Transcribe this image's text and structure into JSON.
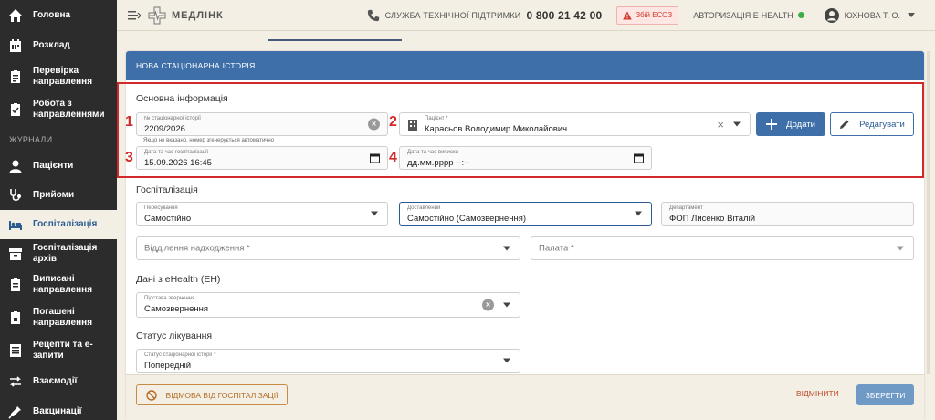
{
  "sidebar": {
    "items": [
      {
        "label": "Головна",
        "icon": "home-icon"
      },
      {
        "label": "Розклад",
        "icon": "calendar-icon"
      },
      {
        "label": "Перевірка направлення",
        "icon": "clipboard-check-icon"
      },
      {
        "label": "Робота з направленнями",
        "icon": "clipboard-list-icon"
      }
    ],
    "section": "ЖУРНАЛИ",
    "journal_items": [
      {
        "label": "Пацієнти",
        "icon": "person-icon"
      },
      {
        "label": "Прийоми",
        "icon": "stethoscope-icon"
      },
      {
        "label": "Госпіталізація",
        "icon": "bed-icon",
        "active": true
      },
      {
        "label": "Госпіталізація архів",
        "icon": "archive-icon"
      },
      {
        "label": "Виписані направлення",
        "icon": "clipboard-out-icon"
      },
      {
        "label": "Погашені направлення",
        "icon": "clipboard-done-icon"
      },
      {
        "label": "Рецепти та е-запити",
        "icon": "prescription-icon"
      },
      {
        "label": "Взаємодії",
        "icon": "exchange-icon"
      },
      {
        "label": "Вакцинації",
        "icon": "syringe-icon"
      }
    ]
  },
  "header": {
    "logo_text": "МЕДЛІНК",
    "support_label": "СЛУЖБА ТЕХНІЧНОЇ ПІДТРИМКИ",
    "support_phone": "0 800 21 42 00",
    "eso_badge": "Збій ЕСОЗ",
    "auth_label": "АВТОРИЗАЦІЯ E-HEALTH",
    "user_name": "ЮХНОВА Т. О."
  },
  "card": {
    "title": "НОВА СТАЦІОНАРНА ІСТОРІЯ",
    "basic": {
      "title": "Основна інформація",
      "history_no_label": "№ стаціонарної історії",
      "history_no_value": "2209/2026",
      "history_hint": "Якщо не вказано, номер згенерується автоматично",
      "patient_label": "Пацієнт *",
      "patient_value": "Карасьов Володимир Миколайович",
      "add_button": "Додати",
      "edit_button": "Редагувати",
      "hosp_date_label": "Дата та час госпіталізації",
      "hosp_date_value": "15.09.2026 16:45",
      "discharge_label": "Дата та час виписки",
      "discharge_value": "дд.мм.рррр --:--"
    },
    "markers": [
      "1",
      "2",
      "3",
      "4"
    ],
    "hospitalization": {
      "title": "Госпіталізація",
      "movement_label": "Пересування",
      "movement_value": "Самостійно",
      "delivered_label": "Доставлений",
      "delivered_value": "Самостійно (Самозвернення)",
      "department_label": "Департамент",
      "department_value": "ФОП Лисенко Віталій",
      "intake_placeholder": "Відділення надходження *",
      "ward_placeholder": "Палата *"
    },
    "ehealth": {
      "title": "Дані з eHealth (ЕН)",
      "basis_label": "Підстава звернення",
      "basis_value": "Самозвернення"
    },
    "treatment": {
      "title": "Статус лікування",
      "status_label": "Статус стаціонарної історії *",
      "status_value": "Попередній"
    }
  },
  "footer": {
    "refuse_button": "ВІДМОВА ВІД ГОСПІТАЛІЗАЦІЇ",
    "cancel_button": "ВІДМІНИТИ",
    "save_button": "ЗБЕРЕГТИ"
  },
  "colors": {
    "primary": "#3e6fa8",
    "sidebar_bg": "#2c2c2c",
    "page_bg": "#f3efe4",
    "highlight_red": "#d22a2a"
  }
}
